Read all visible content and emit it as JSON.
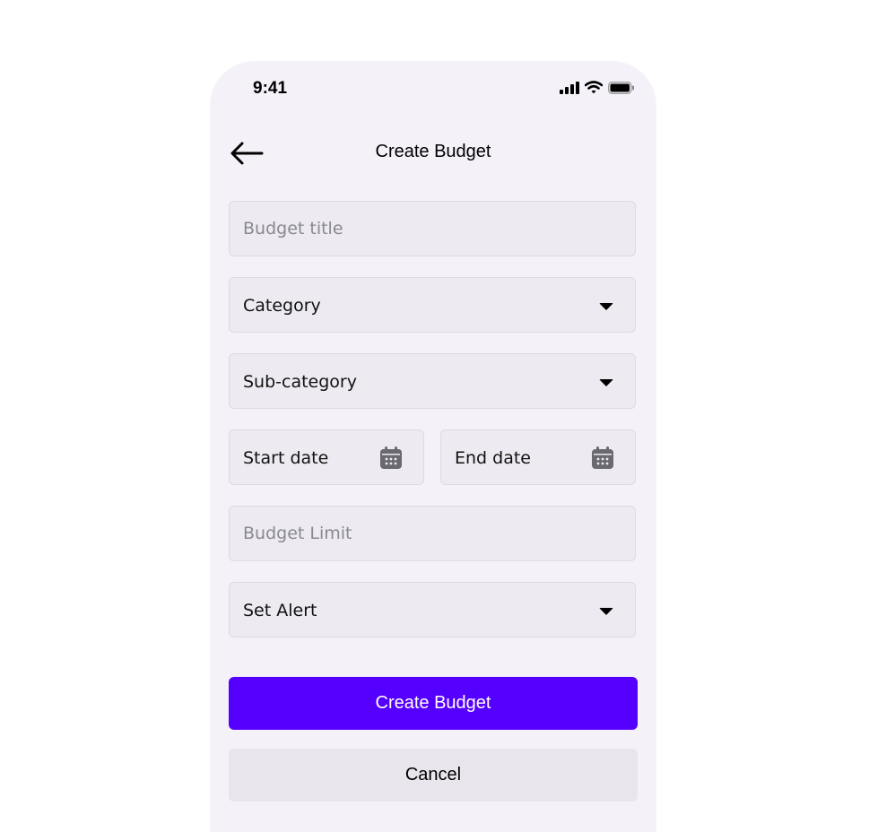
{
  "status_bar": {
    "time": "9:41",
    "icons": [
      "signal-icon",
      "wifi-icon",
      "battery-icon"
    ]
  },
  "header": {
    "title": "Create Budget",
    "back_icon": "arrow-left-icon"
  },
  "form": {
    "budget_title_placeholder": "Budget title",
    "category_label": "Category",
    "subcategory_label": "Sub-category",
    "start_date_label": "Start date",
    "end_date_label": "End date",
    "budget_limit_placeholder": "Budget Limit",
    "set_alert_label": "Set Alert"
  },
  "actions": {
    "create_label": "Create Budget",
    "cancel_label": "Cancel"
  },
  "colors": {
    "accent": "#5500ff",
    "background": "#f4f2f8",
    "field": "#edebf1"
  }
}
